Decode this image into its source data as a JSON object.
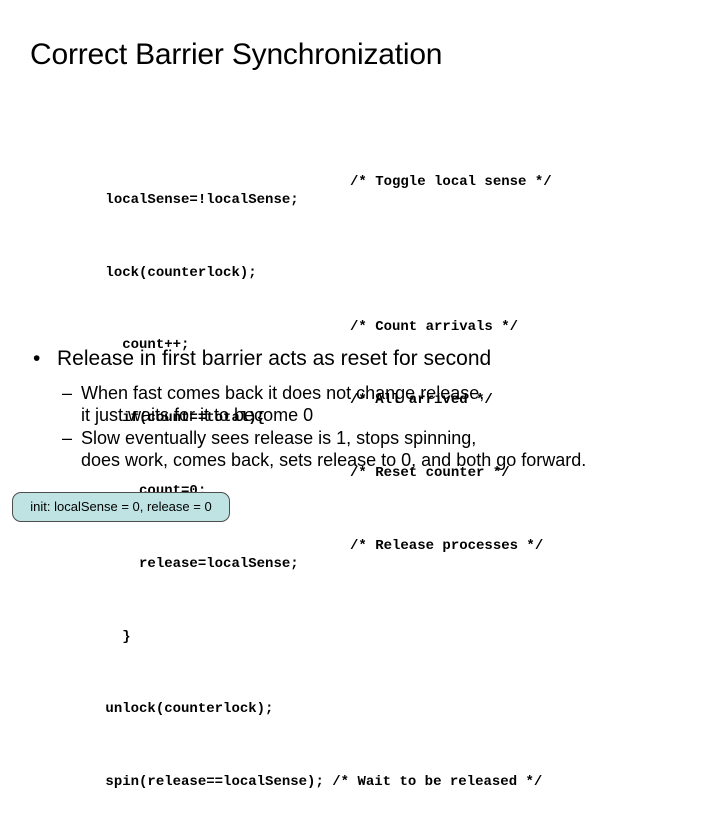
{
  "slide": {
    "title": "Correct Barrier Synchronization",
    "background_color": "#ffffff",
    "text_color": "#000000"
  },
  "code": {
    "lines": [
      {
        "stmt": "localSense=!localSense;",
        "comment": "/* Toggle local sense */",
        "inline": false
      },
      {
        "stmt": "lock(counterlock);",
        "comment": "",
        "inline": false
      },
      {
        "stmt": "  count++;",
        "comment": "/* Count arrivals */",
        "inline": false
      },
      {
        "stmt": "  if(count==total){",
        "comment": "/* All arrived */",
        "inline": false
      },
      {
        "stmt": "    count=0;",
        "comment": "/* Reset counter */",
        "inline": false
      },
      {
        "stmt": "    release=localSense;",
        "comment": "/* Release processes */",
        "inline": false
      },
      {
        "stmt": "  }",
        "comment": "",
        "inline": false
      },
      {
        "stmt": "unlock(counterlock);",
        "comment": "",
        "inline": false
      },
      {
        "stmt": "spin(release==localSense); ",
        "comment": "/* Wait to be released */",
        "inline": true
      }
    ]
  },
  "bullets": {
    "bullet_marker": "•",
    "dash_marker": "–",
    "level1": [
      {
        "text": "Release in first barrier acts as reset for second"
      }
    ],
    "level2": [
      {
        "line1": "When fast comes back it does not change release,",
        "line2": "it just waits for it to become 0"
      },
      {
        "line1": "Slow eventually sees release is 1, stops spinning,",
        "line2": "does work, comes back, sets release to 0, and both go forward."
      }
    ]
  },
  "init_box": {
    "label": "init: localSense = 0, release = 0",
    "fill_color": "#bfe3e3",
    "border_color": "#4d4d4d"
  }
}
